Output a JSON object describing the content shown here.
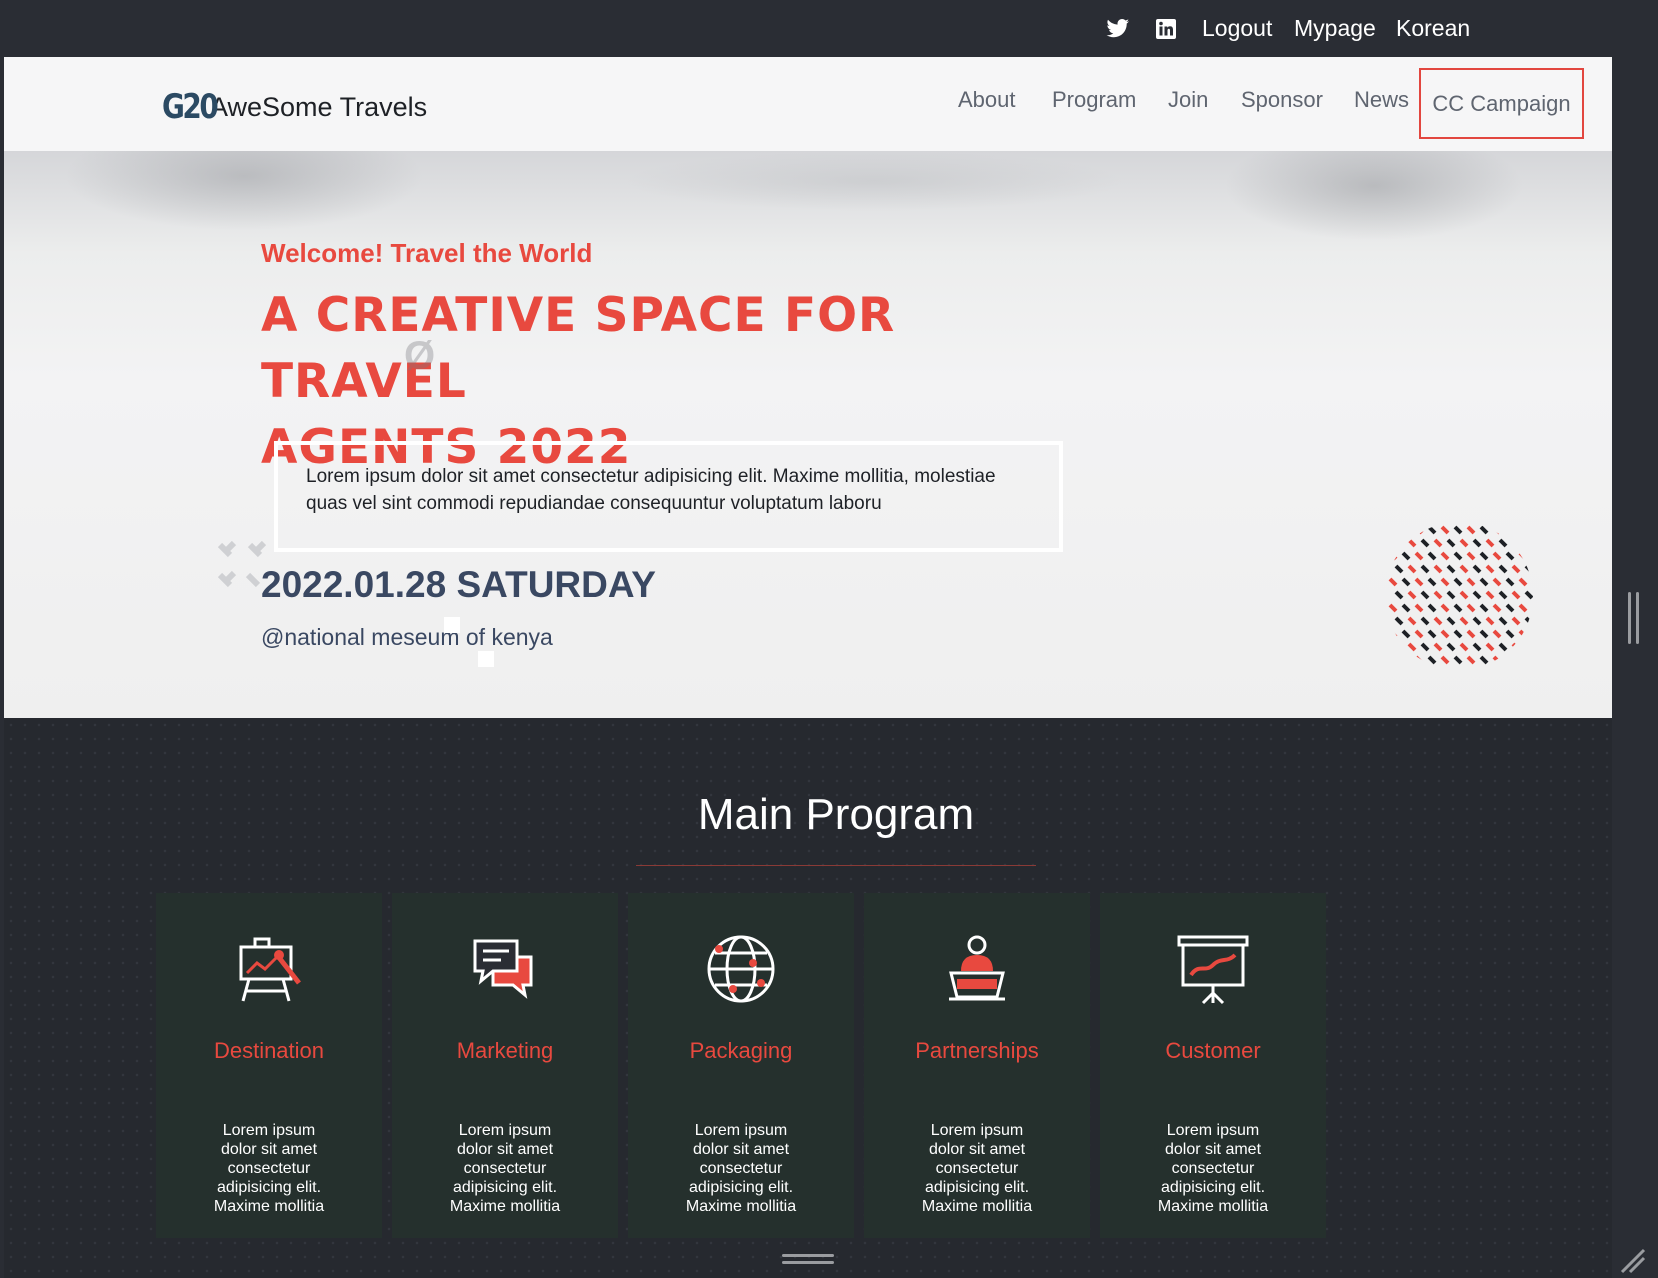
{
  "topbar": {
    "icons": [
      "twitter-icon",
      "linkedin-icon"
    ],
    "links": [
      "Logout",
      "Mypage",
      "Korean"
    ]
  },
  "header": {
    "logo_mark": "G20",
    "logo_text": "AweSome Travels",
    "nav": [
      "About",
      "Program",
      "Join",
      "Sponsor",
      "News"
    ],
    "highlighted_nav": "CC Campaign"
  },
  "hero": {
    "welcome": "Welcome! Travel the World",
    "headline_line1": "A CREATIVE SPACE FOR TRAVEL",
    "headline_line2": "AGENTS 2022",
    "intro": "Lorem ipsum dolor sit amet consectetur adipisicing elit. Maxime mollitia, molestiae quas vel sint commodi repudiandae consequuntur voluptatum laboru",
    "date": "2022.01.28 SATURDAY",
    "venue": "@national meseum of kenya"
  },
  "program": {
    "title": "Main Program",
    "cards": [
      {
        "title": "Destination",
        "icon": "easel-icon",
        "desc": "Lorem ipsum dolor sit amet consectetur adipisicing elit. Maxime mollitia"
      },
      {
        "title": "Marketing",
        "icon": "chat-bubbles-icon",
        "desc": "Lorem ipsum dolor sit amet consectetur adipisicing elit. Maxime mollitia"
      },
      {
        "title": "Packaging",
        "icon": "globe-icon",
        "desc": "Lorem ipsum dolor sit amet consectetur adipisicing elit. Maxime mollitia"
      },
      {
        "title": "Partnerships",
        "icon": "speaker-podium-icon",
        "desc": "Lorem ipsum dolor sit amet consectetur adipisicing elit. Maxime mollitia"
      },
      {
        "title": "Customer",
        "icon": "presentation-board-icon",
        "desc": "Lorem ipsum dolor sit amet consectetur adipisicing elit. Maxime mollitia"
      }
    ]
  },
  "colors": {
    "accent": "#e8493f",
    "dark_bg": "#2a2d34",
    "card_bg": "#25302d",
    "date_text": "#3a4862"
  }
}
